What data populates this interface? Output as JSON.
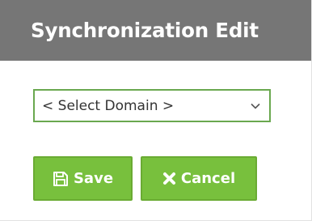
{
  "header": {
    "title": "Synchronization Edit"
  },
  "form": {
    "domain_select": {
      "selected": "< Select Domain >"
    }
  },
  "actions": {
    "save_label": "Save",
    "cancel_label": "Cancel"
  },
  "icons": {
    "save": "floppy-disk-icon",
    "cancel": "x-icon",
    "select": "chevron-down-icon"
  },
  "colors": {
    "header_background": "#767676",
    "header_text": "#ffffff",
    "button_background": "#78c03d",
    "select_border": "#6aa84f"
  }
}
